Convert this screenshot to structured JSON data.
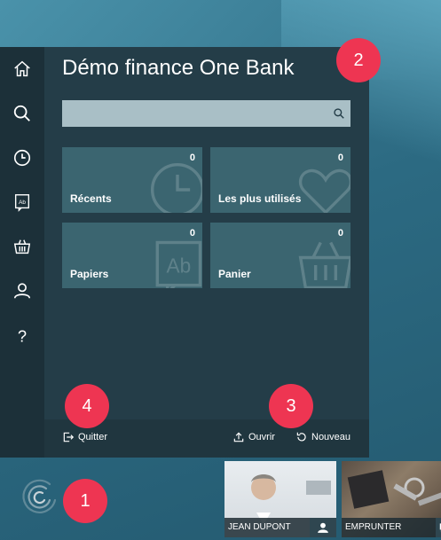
{
  "app": {
    "title": "Démo finance One Bank"
  },
  "sidebar": {
    "items": [
      {
        "icon": "home-icon"
      },
      {
        "icon": "search-icon"
      },
      {
        "icon": "clock-icon"
      },
      {
        "icon": "document-icon"
      },
      {
        "icon": "basket-icon"
      },
      {
        "icon": "user-icon"
      },
      {
        "icon": "help-icon"
      }
    ]
  },
  "search": {
    "value": "",
    "placeholder": ""
  },
  "tiles": [
    {
      "label": "Récents",
      "count": "0",
      "icon": "clock-icon"
    },
    {
      "label": "Les plus utilisés",
      "count": "0",
      "icon": "heart-icon"
    },
    {
      "label": "Papiers",
      "count": "0",
      "icon": "document-icon"
    },
    {
      "label": "Panier",
      "count": "0",
      "icon": "basket-icon"
    }
  ],
  "actions": {
    "quit": "Quitter",
    "open": "Ouvrir",
    "new": "Nouveau"
  },
  "badges": [
    "1",
    "2",
    "3",
    "4"
  ],
  "cards": [
    {
      "label": "JEAN DUPONT",
      "icon": "user-icon"
    },
    {
      "label": "EMPRUNTER",
      "icon": "chat-icon"
    }
  ],
  "colors": {
    "accent_badge": "#ee3552",
    "panel": "#243d48",
    "sidebar": "#1c3039",
    "tile": "#3b6570"
  }
}
